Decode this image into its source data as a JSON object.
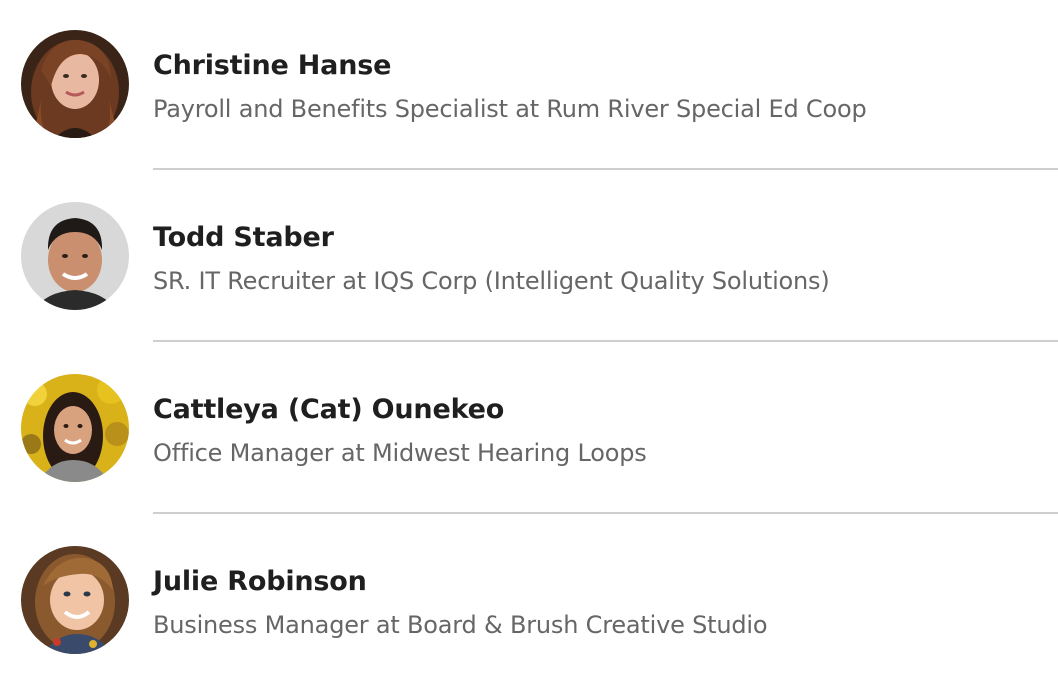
{
  "people": [
    {
      "name": "Christine Hanse",
      "headline": "Payroll and Benefits Specialist at Rum River Special Ed Coop",
      "avatar_icon": "avatar-photo-woman-long-brown-hair"
    },
    {
      "name": "Todd Staber",
      "headline": "SR. IT Recruiter at IQS Corp (Intelligent Quality Solutions)",
      "avatar_icon": "avatar-photo-man-dark-hair"
    },
    {
      "name": "Cattleya (Cat) Ounekeo",
      "headline": "Office Manager at Midwest Hearing Loops",
      "avatar_icon": "avatar-photo-woman-yellow-foliage"
    },
    {
      "name": "Julie Robinson",
      "headline": "Business Manager at Board & Brush Creative Studio",
      "avatar_icon": "avatar-photo-woman-smiling"
    }
  ],
  "colors": {
    "name_text": "#1f1f1f",
    "headline_text": "#666666",
    "divider": "#cfcfcf",
    "background": "#ffffff"
  }
}
